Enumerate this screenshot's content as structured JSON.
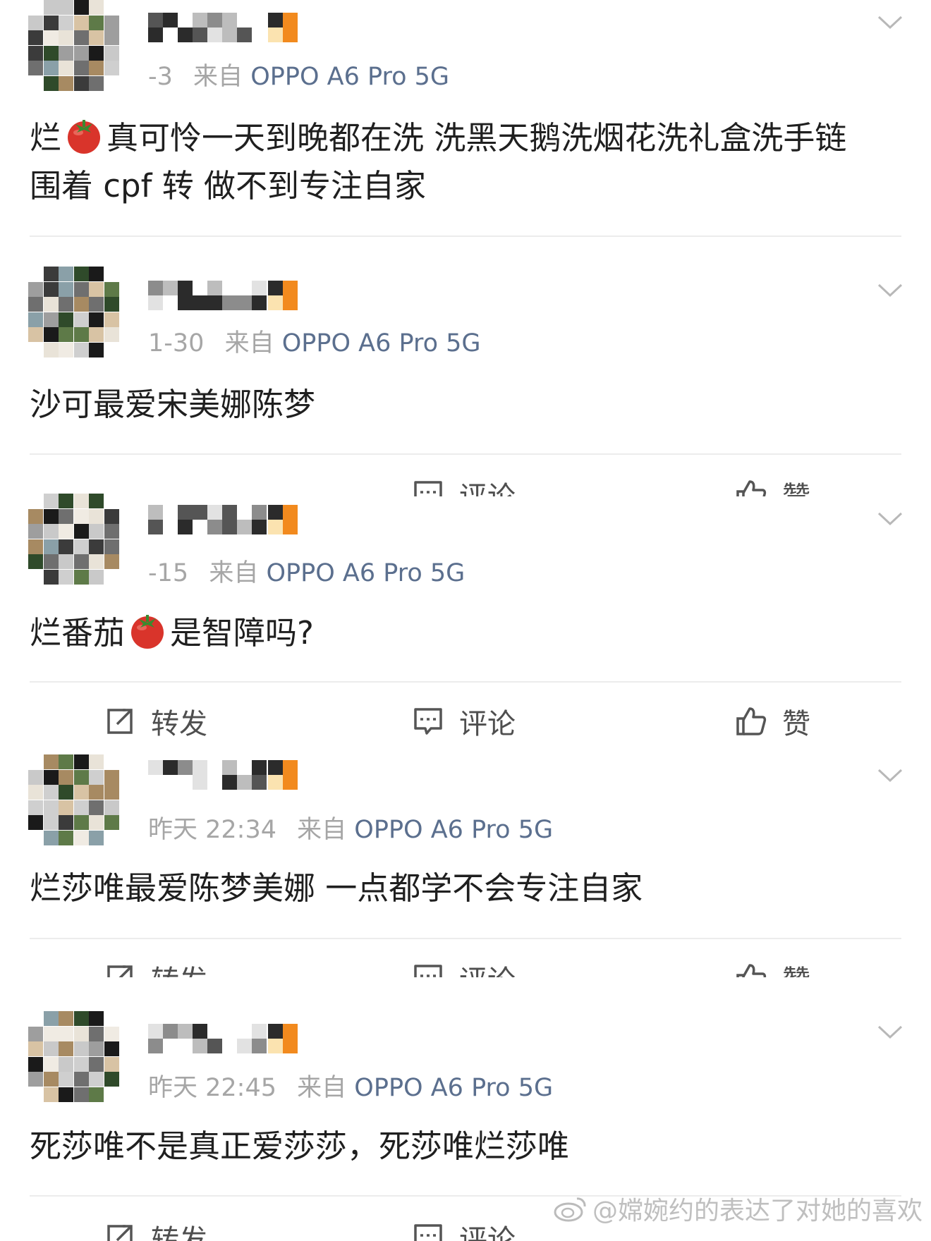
{
  "comments": [
    {
      "time": "-3",
      "source_label": "来自",
      "device": "OPPO A6 Pro 5G",
      "content_parts": [
        "烂",
        "真可怜一天到晚都在洗 洗黑天鹅洗烟花洗礼盒洗手链"
      ],
      "content_line2": "围着 cpf 转 做不到专注自家"
    },
    {
      "time": "1-30",
      "source_label": "来自",
      "device": "OPPO A6 Pro 5G",
      "content": "沙可最爱宋美娜陈梦"
    },
    {
      "time": "-15",
      "source_label": "来自",
      "device": "OPPO A6 Pro 5G",
      "content_parts": [
        "烂番茄",
        "是智障吗?"
      ]
    },
    {
      "time": "昨天 22:34",
      "source_label": "来自",
      "device": "OPPO A6 Pro 5G",
      "content": "烂莎唯最爱陈梦美娜 一点都学不会专注自家"
    },
    {
      "time": "昨天 22:45",
      "source_label": "来自",
      "device": "OPPO A6 Pro 5G",
      "content": "死莎唯不是真正爱莎莎，死莎唯烂莎唯"
    }
  ],
  "actions": {
    "repost": "转发",
    "comment": "评论",
    "like": "赞"
  },
  "watermark": "@嫦婉约的表达了对她的喜欢",
  "icons": [
    "chevron-down-icon",
    "repost-icon",
    "comment-icon",
    "thumbs-up-icon",
    "tomato-emoji-icon",
    "weibo-logo-icon"
  ],
  "colors": {
    "device_link": "#5b6f8e",
    "meta_gray": "#a6a6a6",
    "tomato": "#d9342b"
  }
}
